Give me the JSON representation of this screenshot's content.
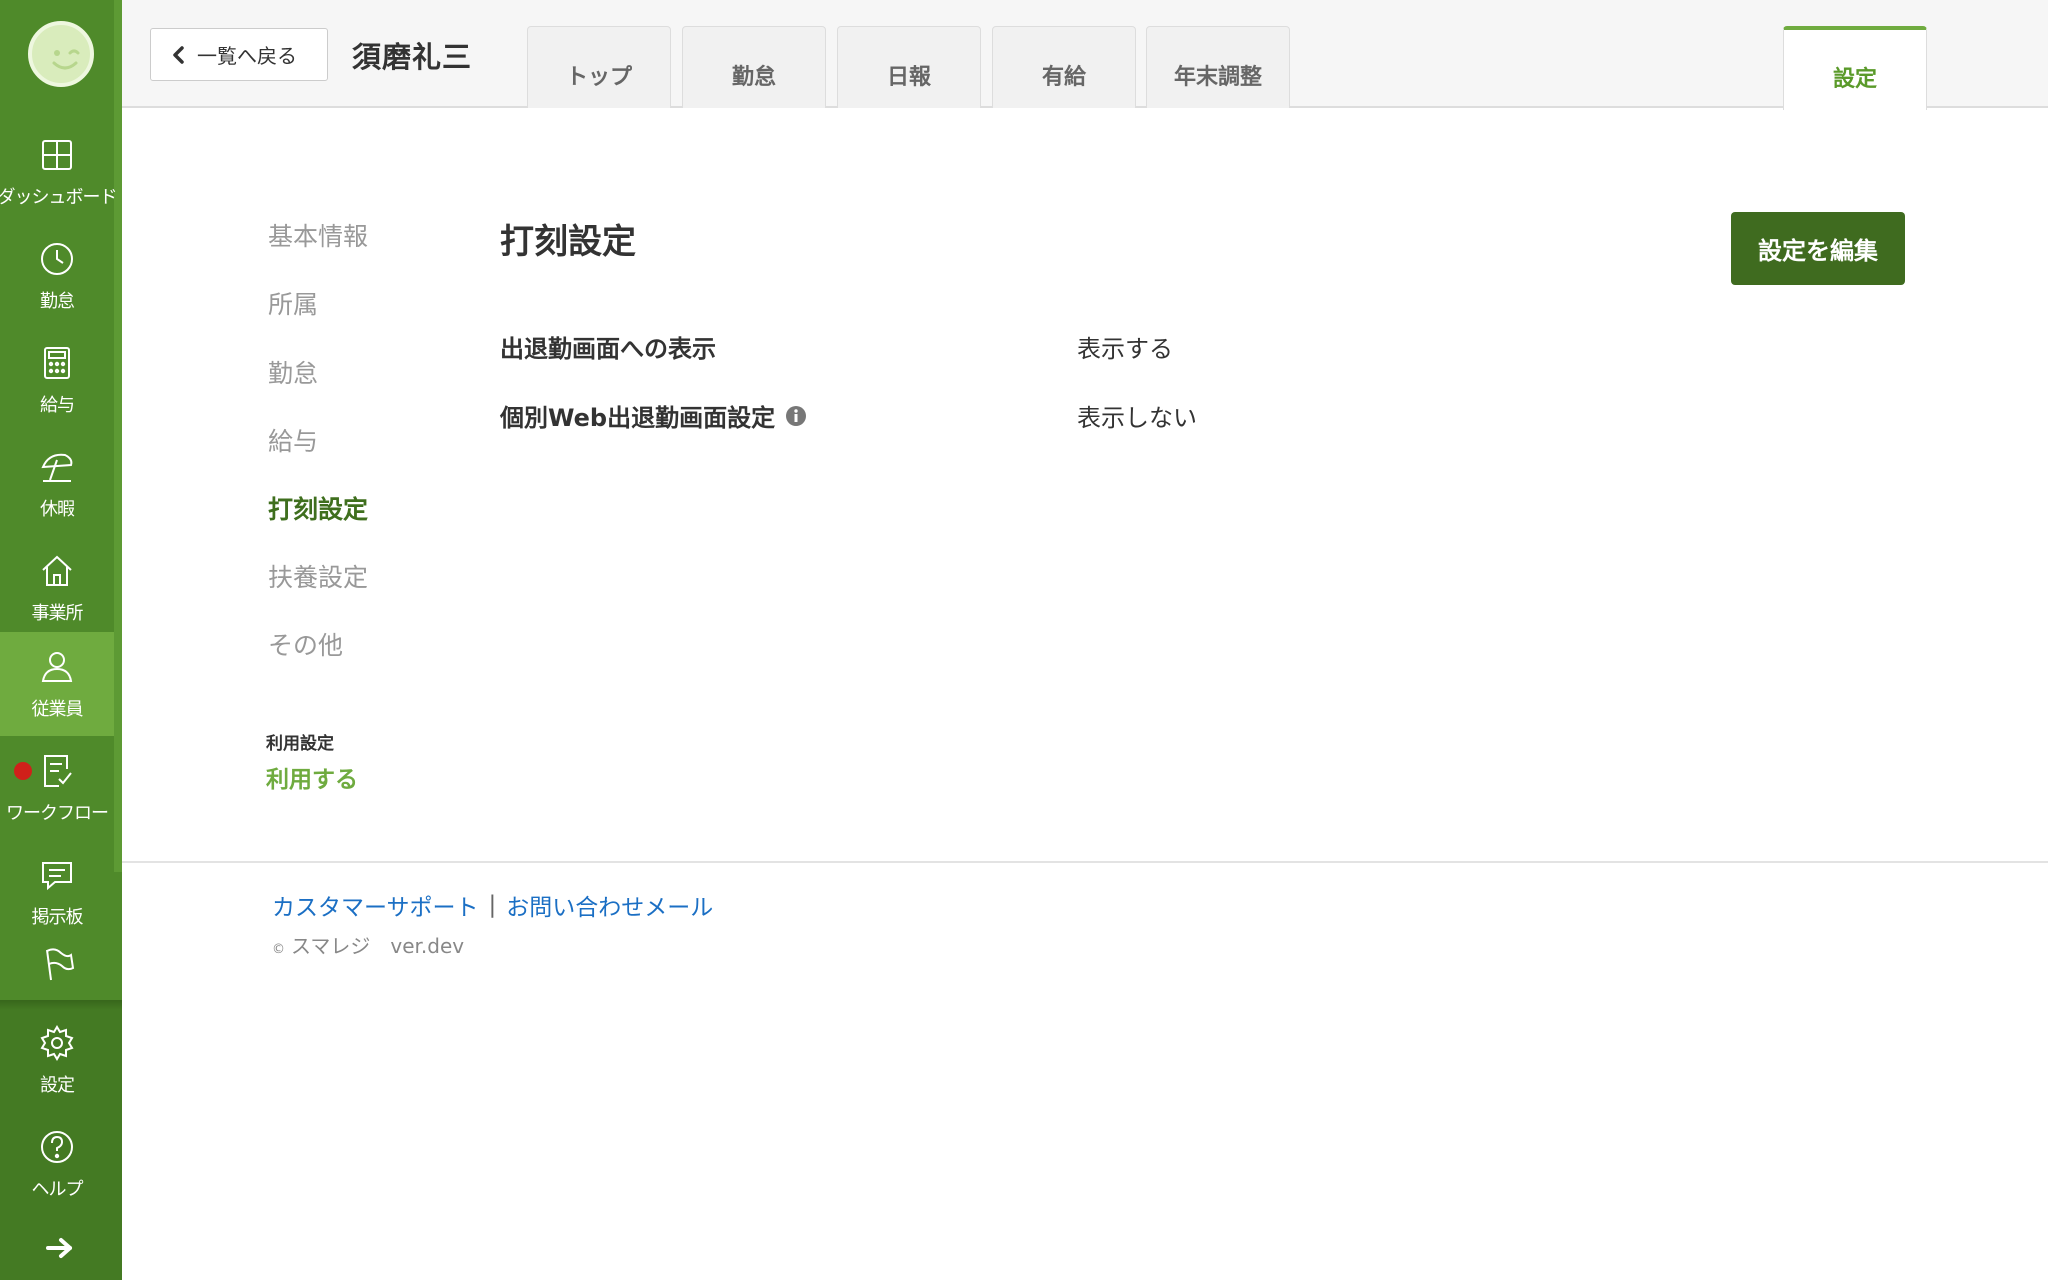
{
  "sidebar": {
    "items": [
      {
        "label": "ダッシュボード",
        "icon": "dashboard-icon"
      },
      {
        "label": "勤怠",
        "icon": "clock-icon"
      },
      {
        "label": "給与",
        "icon": "calculator-icon"
      },
      {
        "label": "休暇",
        "icon": "umbrella-icon"
      },
      {
        "label": "事業所",
        "icon": "home-icon"
      },
      {
        "label": "従業員",
        "icon": "user-icon",
        "active": true
      },
      {
        "label": "ワークフロー",
        "icon": "checklist-icon",
        "has_notification": true
      },
      {
        "label": "掲示板",
        "icon": "chat-icon"
      }
    ],
    "bottom_items": [
      {
        "label": "設定",
        "icon": "gear-icon"
      },
      {
        "label": "ヘルプ",
        "icon": "help-icon"
      }
    ],
    "flag_icon": "flag-icon",
    "expand_icon": "arrow-right-icon"
  },
  "header": {
    "back_label": "一覧へ戻る",
    "employee_name": "須磨礼三",
    "tabs": [
      {
        "label": "トップ"
      },
      {
        "label": "勤怠"
      },
      {
        "label": "日報"
      },
      {
        "label": "有給"
      },
      {
        "label": "年末調整"
      }
    ],
    "active_tab": {
      "label": "設定"
    }
  },
  "subnav": {
    "items": [
      {
        "label": "基本情報"
      },
      {
        "label": "所属"
      },
      {
        "label": "勤怠"
      },
      {
        "label": "給与"
      },
      {
        "label": "打刻設定",
        "active": true
      },
      {
        "label": "扶養設定"
      },
      {
        "label": "その他"
      }
    ],
    "usage_label": "利用設定",
    "usage_value": "利用する"
  },
  "main": {
    "title": "打刻設定",
    "edit_label": "設定を編集",
    "rows": [
      {
        "label": "出退勤画面への表示",
        "value": "表示する"
      },
      {
        "label": "個別Web出退勤画面設定",
        "value": "表示しない",
        "info_icon": "info-icon"
      }
    ]
  },
  "footer": {
    "support_link": "カスタマーサポート",
    "separator": "|",
    "contact_link": "お問い合わせメール",
    "copyright_mark": "©",
    "copyright": "スマレジ　ver.dev"
  },
  "colors": {
    "sidebar": "#4f8a2a",
    "sidebar_active": "#6fab3f",
    "accent_dark": "#3f6b1f",
    "link": "#1b6fc4"
  }
}
